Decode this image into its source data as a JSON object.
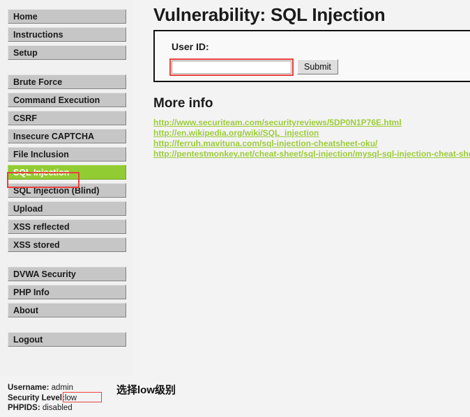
{
  "sidebar": {
    "groups": [
      {
        "items": [
          {
            "label": "Home",
            "active": false
          },
          {
            "label": "Instructions",
            "active": false
          },
          {
            "label": "Setup",
            "active": false
          }
        ]
      },
      {
        "items": [
          {
            "label": "Brute Force",
            "active": false
          },
          {
            "label": "Command Execution",
            "active": false
          },
          {
            "label": "CSRF",
            "active": false
          },
          {
            "label": "Insecure CAPTCHA",
            "active": false
          },
          {
            "label": "File Inclusion",
            "active": false
          },
          {
            "label": "SQL Injection",
            "active": true
          },
          {
            "label": "SQL Injection (Blind)",
            "active": false
          },
          {
            "label": "Upload",
            "active": false
          },
          {
            "label": "XSS reflected",
            "active": false
          },
          {
            "label": "XSS stored",
            "active": false
          }
        ]
      },
      {
        "items": [
          {
            "label": "DVWA Security",
            "active": false
          },
          {
            "label": "PHP Info",
            "active": false
          },
          {
            "label": "About",
            "active": false
          }
        ]
      },
      {
        "items": [
          {
            "label": "Logout",
            "active": false
          }
        ]
      }
    ]
  },
  "system_info": {
    "username_label": "Username:",
    "username_value": "admin",
    "security_level_label": "Security Level:",
    "security_level_value": "low",
    "phpids_label": "PHPIDS:",
    "phpids_value": "disabled"
  },
  "annotation": {
    "chinese_note": "选择low级别",
    "box_color": "#e8413c"
  },
  "main": {
    "title": "Vulnerability: SQL Injection",
    "form": {
      "label": "User ID:",
      "input_value": "",
      "input_placeholder": "",
      "submit_label": "Submit"
    },
    "more_info": {
      "heading": "More info",
      "links": [
        "http://www.securiteam.com/securityreviews/5DP0N1P76E.html",
        "http://en.wikipedia.org/wiki/SQL_injection",
        "http://ferruh.mavituna.com/sql-injection-cheatsheet-oku/",
        "http://pentestmonkey.net/cheat-sheet/sql-injection/mysql-sql-injection-cheat-sheet"
      ]
    }
  },
  "colors": {
    "accent_green": "#92cc33",
    "link_green": "#9ccc3a",
    "annotation_red": "#e8413c",
    "button_gray": "#c6c6c6"
  }
}
